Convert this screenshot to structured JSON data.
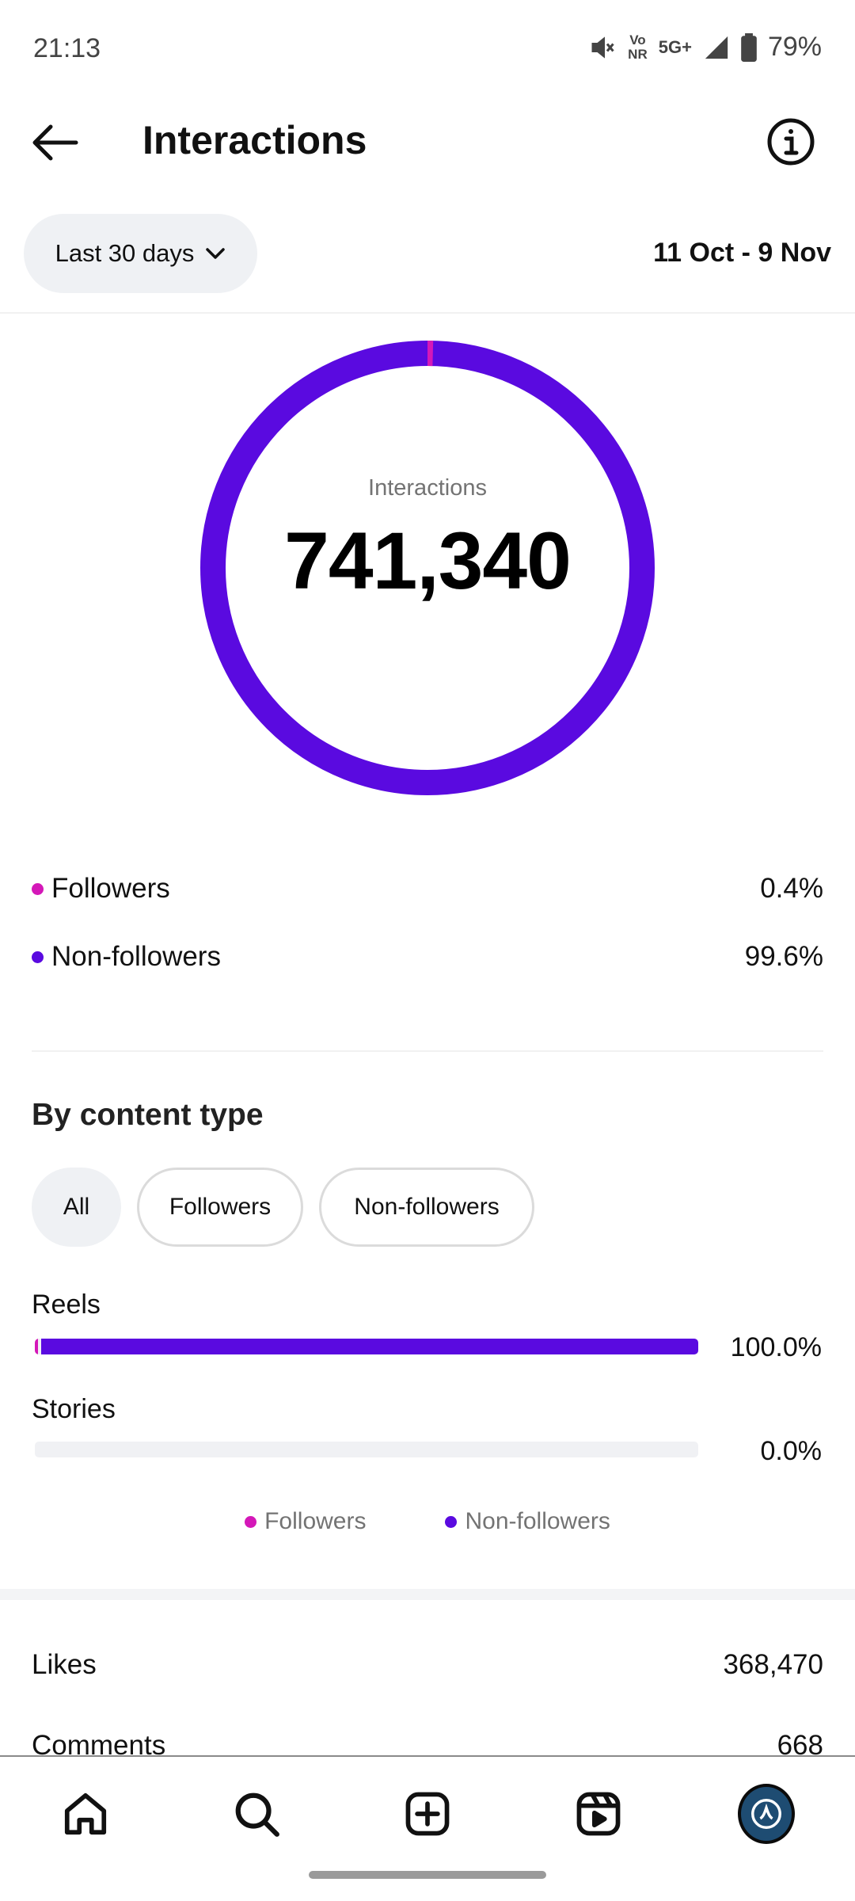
{
  "status_bar": {
    "time": "21:13",
    "volte_top": "Vo",
    "volte_bottom": "NR",
    "network": "5G+",
    "battery": "79%"
  },
  "header": {
    "title": "Interactions",
    "back_icon": "arrow-left-icon",
    "info_icon": "info-icon"
  },
  "filters": {
    "range_label": "Last 30 days",
    "date_range": "11 Oct - 9 Nov"
  },
  "summary": {
    "ring_label": "Interactions",
    "total": "741,340",
    "followers_share": 0.004,
    "non_followers_share": 0.996,
    "legend": [
      {
        "label": "Followers",
        "value": "0.4%"
      },
      {
        "label": "Non-followers",
        "value": "99.6%"
      }
    ]
  },
  "colors": {
    "followers": "#d418b8",
    "non_followers": "#5a0ae0"
  },
  "content_type": {
    "title": "By content type",
    "chips": [
      "All",
      "Followers",
      "Non-followers"
    ],
    "selected_chip": "All",
    "bars": [
      {
        "label": "Reels",
        "value": "100.0%",
        "followers_share": 0.004,
        "non_followers_share": 0.996
      },
      {
        "label": "Stories",
        "value": "0.0%",
        "followers_share": 0,
        "non_followers_share": 0
      }
    ],
    "legend": [
      "Followers",
      "Non-followers"
    ]
  },
  "metrics": [
    {
      "label": "Likes",
      "value": "368,470"
    },
    {
      "label": "Comments",
      "value": "668"
    }
  ],
  "bottom_nav": [
    "home-icon",
    "search-icon",
    "create-icon",
    "reels-icon",
    "profile-avatar"
  ]
}
